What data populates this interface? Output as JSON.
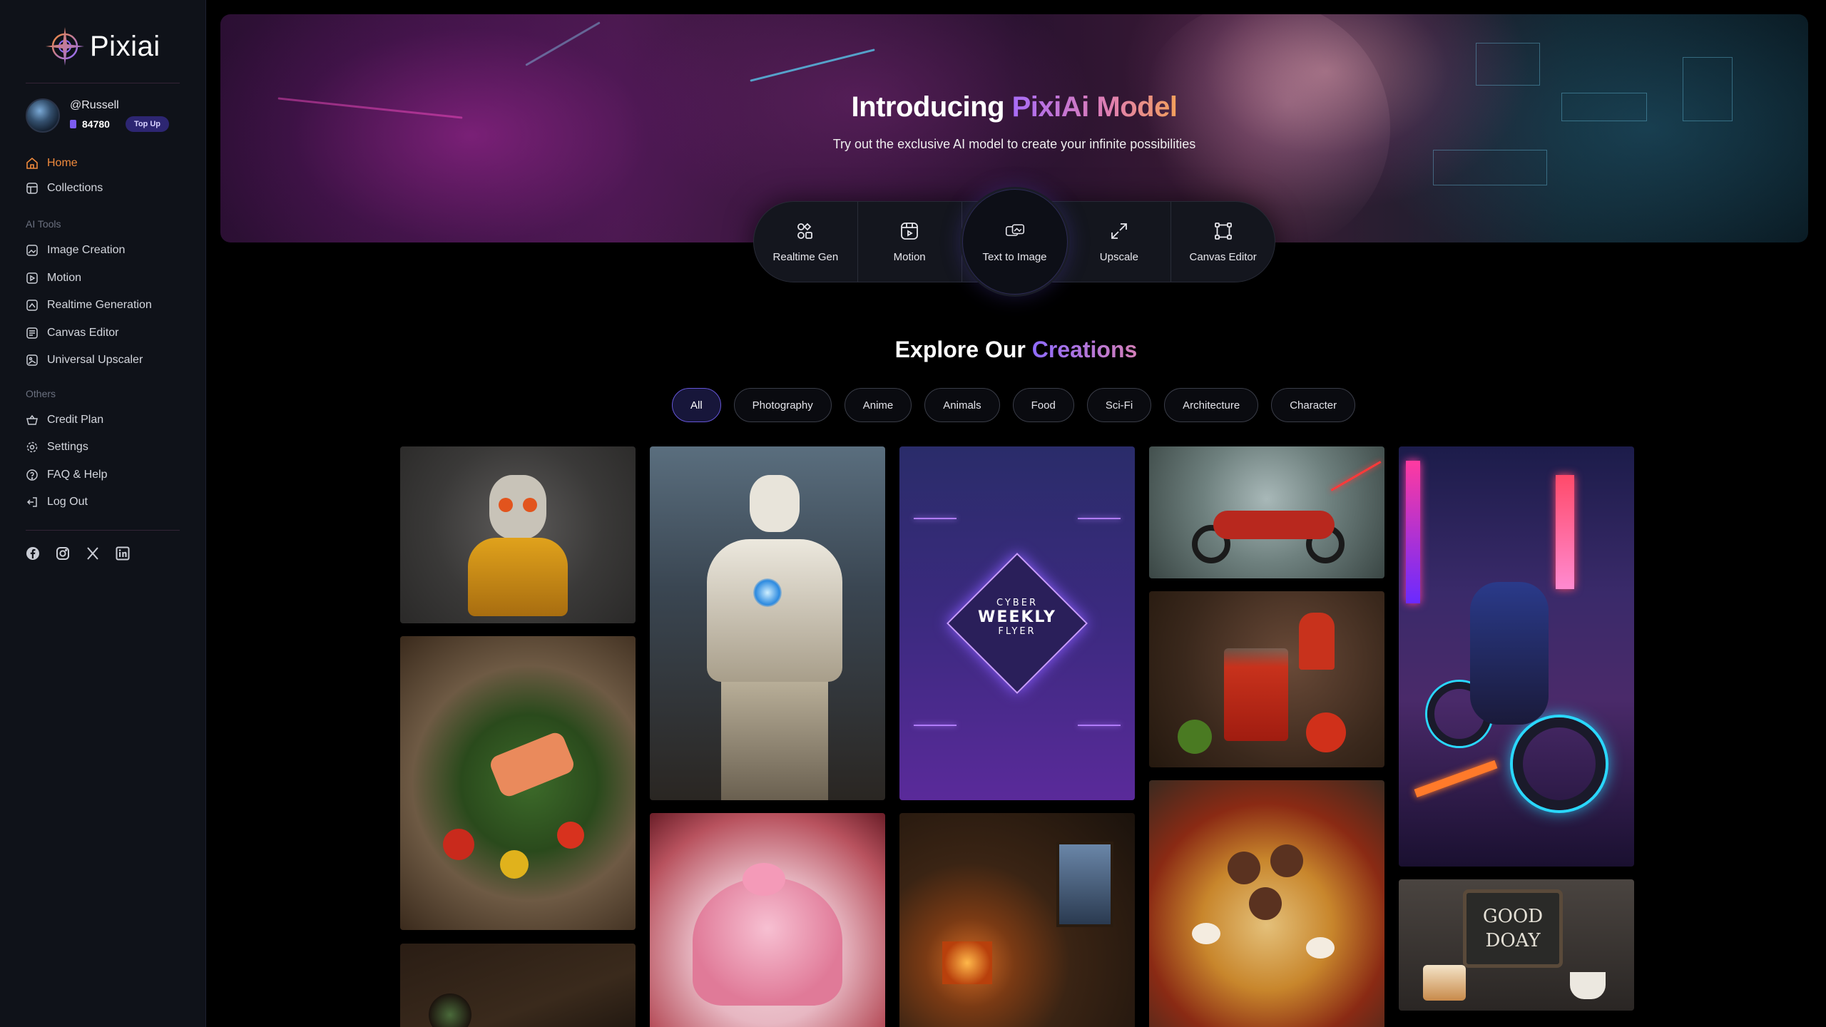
{
  "brand": {
    "name": "Pixiai"
  },
  "user": {
    "handle": "@Russell",
    "credits": "84780",
    "topup_label": "Top Up"
  },
  "nav": {
    "main": [
      {
        "label": "Home",
        "icon": "home-icon"
      },
      {
        "label": "Collections",
        "icon": "collections-icon"
      }
    ],
    "ai_tools_label": "AI Tools",
    "ai_tools": [
      {
        "label": "Image Creation",
        "icon": "image-creation-icon"
      },
      {
        "label": "Motion",
        "icon": "motion-icon"
      },
      {
        "label": "Realtime Generation",
        "icon": "realtime-icon"
      },
      {
        "label": "Canvas Editor",
        "icon": "canvas-icon"
      },
      {
        "label": "Universal Upscaler",
        "icon": "upscaler-icon"
      }
    ],
    "others_label": "Others",
    "others": [
      {
        "label": "Credit Plan",
        "icon": "basket-icon"
      },
      {
        "label": "Settings",
        "icon": "gear-icon"
      },
      {
        "label": "FAQ & Help",
        "icon": "help-icon"
      },
      {
        "label": "Log Out",
        "icon": "logout-icon"
      }
    ],
    "active": "Home"
  },
  "socials": [
    "facebook-icon",
    "instagram-icon",
    "x-icon",
    "linkedin-icon"
  ],
  "hero": {
    "title_plain": "Introducing ",
    "title_highlight": "PixiAi Model",
    "subtitle": "Try out the exclusive AI model to create your infinite possibilities"
  },
  "tools": [
    {
      "label": "Realtime Gen",
      "icon": "realtime-gen-icon"
    },
    {
      "label": "Motion",
      "icon": "motion-icon"
    },
    {
      "label": "Text to Image",
      "icon": "text-to-image-icon",
      "selected": true
    },
    {
      "label": "Upscale",
      "icon": "upscale-icon"
    },
    {
      "label": "Canvas Editor",
      "icon": "canvas-editor-icon"
    }
  ],
  "explore": {
    "title_plain": "Explore Our ",
    "title_highlight": "Creations",
    "filters": [
      "All",
      "Photography",
      "Anime",
      "Animals",
      "Food",
      "Sci-Fi",
      "Architecture",
      "Character"
    ],
    "active_filter": "All"
  },
  "gallery": {
    "flyer_lines": [
      "CYBER",
      "WEEKLY",
      "FLYER"
    ],
    "chalkboard_lines": [
      "GOOD",
      "DOAY"
    ]
  },
  "colors": {
    "accent": "#f08a3c",
    "purple": "#8f6bff",
    "sidebar_bg": "#0f1219"
  }
}
